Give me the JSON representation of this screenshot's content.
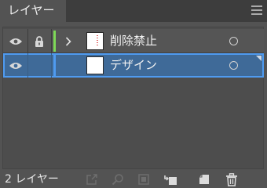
{
  "panel": {
    "tab_title": "レイヤー",
    "menu_icon": "hamburger-menu-icon"
  },
  "layers": [
    {
      "name": "削除禁止",
      "visible": true,
      "locked": true,
      "has_children": true,
      "color": "#7ed957",
      "selected": false
    },
    {
      "name": "デザイン",
      "visible": true,
      "locked": false,
      "has_children": false,
      "color": "#4f9bf0",
      "selected": true
    }
  ],
  "footer": {
    "layer_count": "2 レイヤー",
    "buttons": [
      "export-icon",
      "search-icon",
      "make-clipping-mask-icon",
      "create-sublayer-icon",
      "new-layer-icon",
      "trash-icon"
    ]
  },
  "colors": {
    "panel_bg": "#535353",
    "selection": "#3f6a98",
    "selection_border": "#4f9bf0"
  }
}
